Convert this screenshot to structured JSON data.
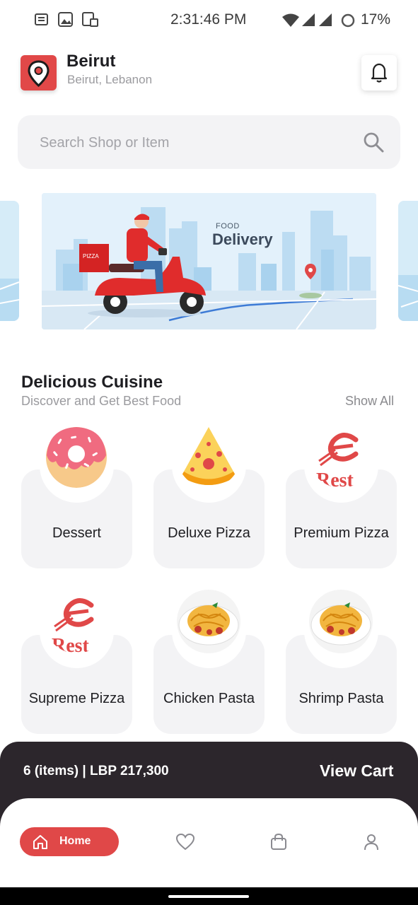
{
  "status_bar": {
    "time": "2:31:46 PM",
    "battery": "17%",
    "icons": [
      "notes-icon",
      "image-icon",
      "sim-icon",
      "wifi-icon",
      "signal-icon",
      "battery-ring-icon"
    ]
  },
  "header": {
    "city": "Beirut",
    "country": "Beirut, Lebanon",
    "location_icon": "location-pin-icon",
    "bell_icon": "bell-icon"
  },
  "search": {
    "placeholder": "Search Shop or Item",
    "icon": "search-icon"
  },
  "banner": {
    "small_text": "FOOD",
    "title": "Delivery"
  },
  "section": {
    "title": "Delicious Cuisine",
    "subtitle": "Discover and Get Best Food",
    "show_all": "Show All"
  },
  "categories": [
    {
      "label": "Dessert",
      "image": "donut-image"
    },
    {
      "label": "Deluxe Pizza",
      "image": "pizza-slice-image"
    },
    {
      "label": "Premium Pizza",
      "image": "resto-logo-image"
    },
    {
      "label": "Supreme Pizza",
      "image": "resto-logo-image"
    },
    {
      "label": "Chicken Pasta",
      "image": "pasta-plate-image"
    },
    {
      "label": "Shrimp Pasta",
      "image": "pasta-plate-image"
    }
  ],
  "cart": {
    "summary": "6 (items) | LBP 217,300",
    "action": "View Cart"
  },
  "bottom_nav": {
    "home_label": "Home",
    "items": [
      "home-icon",
      "heart-icon",
      "bag-icon",
      "user-icon"
    ]
  },
  "colors": {
    "accent": "#e04848",
    "cart_bar": "#2c262c",
    "card_bg": "#f3f3f5"
  }
}
